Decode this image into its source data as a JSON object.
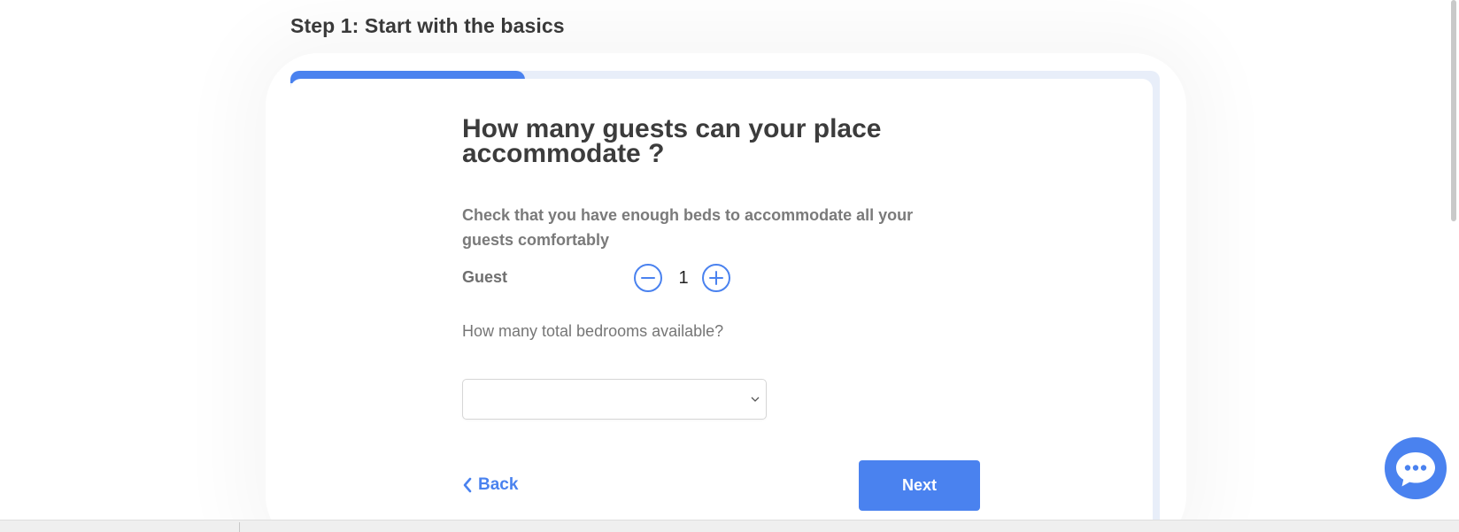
{
  "step": {
    "title": "Step 1: Start with the basics",
    "progress_fraction": 0.27
  },
  "form": {
    "question": "How many guests can your place accommodate ?",
    "hint": "Check that you have enough beds to accommodate all your guests comfortably",
    "guest": {
      "label": "Guest",
      "value": "1",
      "decrement_icon": "minus-circle-icon",
      "increment_icon": "plus-circle-icon"
    },
    "bedrooms": {
      "label": "How many total bedrooms available?",
      "selected": ""
    }
  },
  "nav": {
    "back_label": "Back",
    "next_label": "Next"
  },
  "chat": {
    "icon": "chat-bubble-icon"
  },
  "colors": {
    "accent": "#4a82ef",
    "progress_track": "#e8eef9",
    "heading": "#3c3c3c",
    "muted": "#7a7a7a"
  }
}
